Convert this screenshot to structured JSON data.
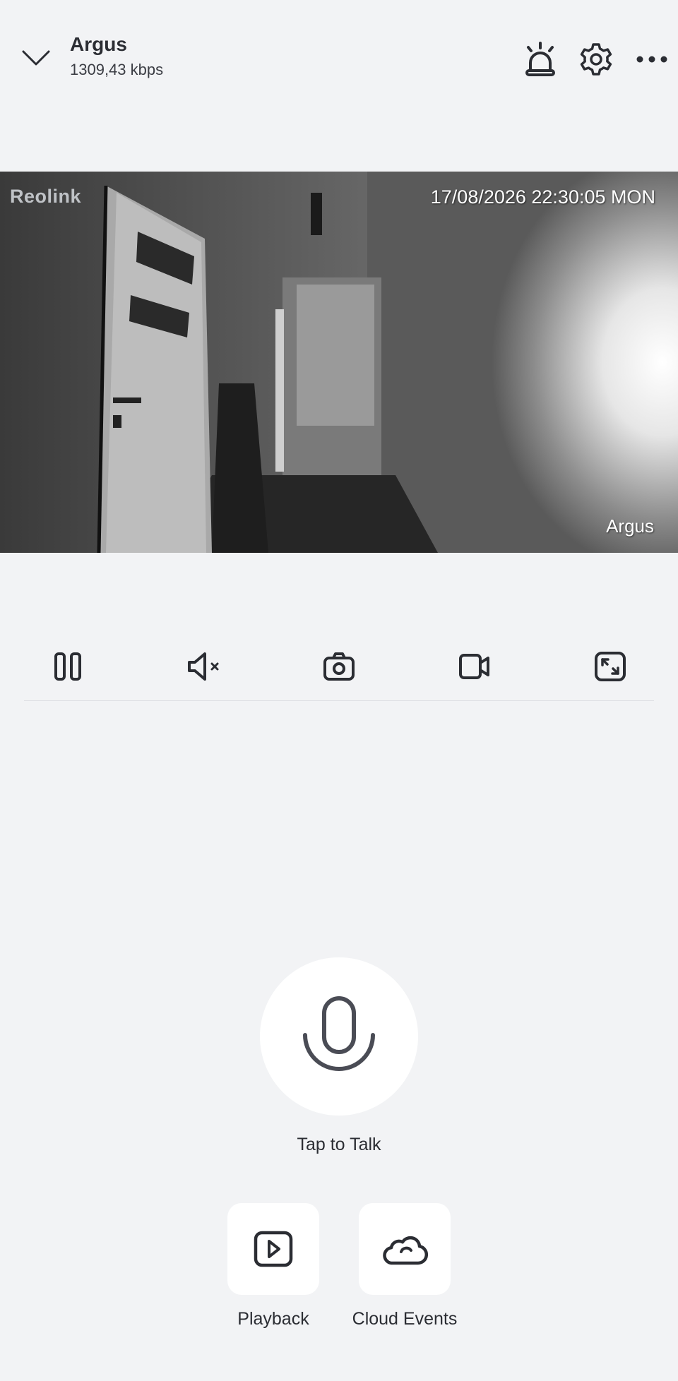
{
  "header": {
    "title": "Argus",
    "bitrate": "1309,43 kbps",
    "icons": [
      "chevron-down-icon",
      "siren-icon",
      "gear-icon",
      "more-icon"
    ]
  },
  "video": {
    "logo": "Reolink",
    "timestamp": "17/08/2026 22:30:05 MON",
    "camera_name": "Argus"
  },
  "controls": [
    "pause-icon",
    "mute-icon",
    "snapshot-icon",
    "record-icon",
    "fullscreen-icon"
  ],
  "talk": {
    "label": "Tap to Talk",
    "icon": "microphone-icon"
  },
  "shortcuts": [
    {
      "label": "Playback",
      "icon": "play-square-icon"
    },
    {
      "label": "Cloud Events",
      "icon": "cloud-icon"
    }
  ],
  "colors": {
    "background": "#f2f3f5",
    "icon": "#2b2d33",
    "tile": "#ffffff"
  }
}
